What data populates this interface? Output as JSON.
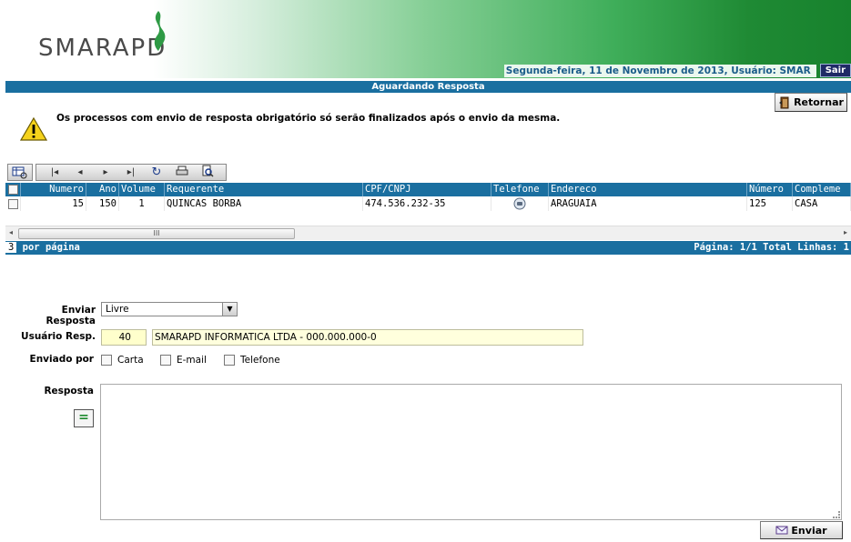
{
  "header": {
    "logo_text": "SMARAPD",
    "date_user": "Segunda-feira, 11 de Novembro de 2013, Usuário: SMAR",
    "logout_label": "Sair"
  },
  "page": {
    "title": "Aguardando Resposta",
    "return_label": "Retornar",
    "warning_text": "Os processos com envio de resposta obrigatório só serão finalizados após o envio da mesma."
  },
  "grid": {
    "columns": [
      "Numero",
      "Ano",
      "Volume",
      "Requerente",
      "CPF/CNPJ",
      "Telefone",
      "Endereco",
      "Número",
      "Compleme"
    ],
    "rows": [
      {
        "numero": "15",
        "ano": "150",
        "volume": "1",
        "requerente": "QUINCAS BORBA",
        "cpf": "474.536.232-35",
        "telefone_icon": "phone-icon",
        "endereco": "ARAGUAIA",
        "num": "125",
        "complemento": "CASA"
      }
    ],
    "scroll_thumb": "III",
    "per_page": "3",
    "per_page_label": "por página",
    "pager_info": "Página: 1/1 Total Linhas: 1"
  },
  "form": {
    "enviar_label": "Enviar Resposta",
    "enviar_value": "Livre",
    "usuario_label": "Usuário Resp.",
    "usuario_code": "40",
    "usuario_name": "SMARAPD INFORMATICA LTDA - 000.000.000-0",
    "enviado_label": "Enviado por",
    "options": [
      "Carta",
      "E-mail",
      "Telefone"
    ],
    "resposta_label": "Resposta",
    "eq_button": "=",
    "send_label": "Enviar"
  },
  "colors": {
    "header_green": "#17822d",
    "bar_blue": "#1a6fa0",
    "field_yellow": "#ffffcc"
  }
}
